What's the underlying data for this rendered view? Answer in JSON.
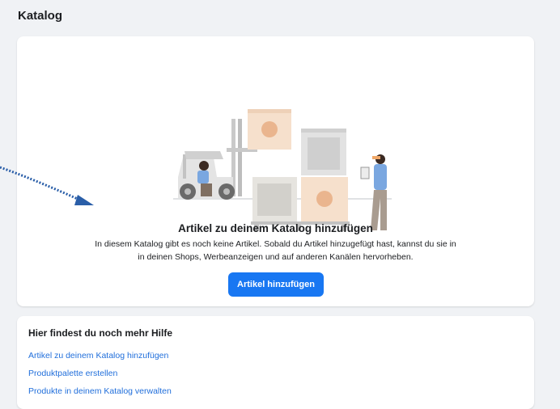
{
  "page": {
    "title": "Katalog"
  },
  "empty_state": {
    "title": "Artikel zu deinem Katalog hinzufügen",
    "description_line1": "In diesem Katalog gibt es noch keine Artikel. Sobald du Artikel hinzugefügt hast, kannst du sie in",
    "description_line2": "in deinen Shops, Werbeanzeigen und auf anderen Kanälen hervorheben.",
    "button_label": "Artikel hinzufügen",
    "illustration": "warehouse-forklift-illustration"
  },
  "help": {
    "title": "Hier findest du noch mehr Hilfe",
    "links": [
      {
        "label": "Artikel zu deinem Katalog hinzufügen"
      },
      {
        "label": "Produktpalette erstellen"
      },
      {
        "label": "Produkte in deinem Katalog verwalten"
      }
    ]
  },
  "colors": {
    "background": "#f0f2f5",
    "primary": "#1877f2",
    "link": "#216fdb",
    "annotation_arrow": "#2a5ea8"
  }
}
